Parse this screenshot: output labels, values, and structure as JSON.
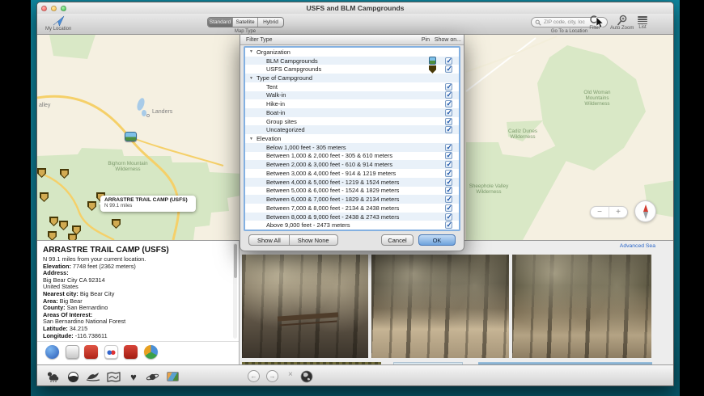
{
  "window": {
    "title": "USFS and BLM Campgrounds"
  },
  "toolbar": {
    "my_location_label": "My Location",
    "map_type_caption": "Map Type",
    "segments": [
      "Standard",
      "Satellite",
      "Hybrid"
    ],
    "search_placeholder": "ZIP code, city, loc",
    "search_caption": "Go To a Location",
    "filter_label": "Filter",
    "auto_zoom_label": "Auto Zoom",
    "list_label": "List"
  },
  "map": {
    "labels": [
      {
        "text": "alley"
      },
      {
        "text": "Landers"
      },
      {
        "text": "Bighorn Mountain\nWilderness"
      },
      {
        "text": "Old Woman\nMountains\nWilderness"
      },
      {
        "text": "Cadiz Dunes\nWilderness"
      },
      {
        "text": "Sheephole Valley\nWilderness"
      }
    ],
    "callout": {
      "title": "ARRASTRE TRAIL CAMP (USFS)",
      "distance": "N 99.1 miles"
    },
    "zoom_out": "−",
    "zoom_in": "+"
  },
  "filter_dialog": {
    "title_col": "Filter Type",
    "pin_col": "Pin",
    "show_col": "Show on...",
    "groups": [
      {
        "label": "Organization",
        "items": [
          {
            "label": "BLM Campgrounds",
            "pin": "blm",
            "checked": true
          },
          {
            "label": "USFS Campgrounds",
            "pin": "usfs",
            "checked": true
          }
        ]
      },
      {
        "label": "Type of Campground",
        "items": [
          {
            "label": "Tent",
            "checked": true
          },
          {
            "label": "Walk-in",
            "checked": true
          },
          {
            "label": "Hike-in",
            "checked": true
          },
          {
            "label": "Boat-in",
            "checked": true
          },
          {
            "label": "Group sites",
            "checked": true
          },
          {
            "label": "Uncategorized",
            "checked": true
          }
        ]
      },
      {
        "label": "Elevation",
        "items": [
          {
            "label": "Below 1,000 feet - 305 meters",
            "checked": true
          },
          {
            "label": "Between 1,000 & 2,000 feet - 305 & 610 meters",
            "checked": true
          },
          {
            "label": "Between 2,000 & 3,000 feet - 610 & 914 meters",
            "checked": true
          },
          {
            "label": "Between 3,000 & 4,000 feet - 914 & 1219 meters",
            "checked": true
          },
          {
            "label": "Between 4,000 & 5,000 feet - 1219 & 1524 meters",
            "checked": true
          },
          {
            "label": "Between 5,000 & 6,000 feet - 1524 & 1829 meters",
            "checked": true
          },
          {
            "label": "Between 6,000 & 7,000 feet - 1829 & 2134 meters",
            "checked": true
          },
          {
            "label": "Between 7,000 & 8,000 feet - 2134 & 2438 meters",
            "checked": true
          },
          {
            "label": "Between 8,000 & 9,000 feet - 2438 & 2743 meters",
            "checked": true
          },
          {
            "label": "Above 9,000 feet - 2473 meters",
            "checked": true
          }
        ]
      }
    ],
    "show_all": "Show All",
    "show_none": "Show None",
    "cancel": "Cancel",
    "ok": "OK"
  },
  "detail_panel": {
    "title": "ARRASTRE TRAIL CAMP (USFS)",
    "lines": [
      {
        "t": "N 99.1 miles from your current location."
      },
      {
        "b": "Elevation:",
        "t": " 7748 feet (2362 meters)"
      },
      {
        "b": "Address:"
      },
      {
        "t": "Big Bear City CA 92314"
      },
      {
        "t": "United States"
      },
      {
        "b": "Nearest city:",
        "t": " Big Bear City"
      },
      {
        "b": "Area:",
        "t": " Big Bear"
      },
      {
        "b": "County:",
        "t": " San Bernardino"
      },
      {
        "b": "Areas Of Interest:"
      },
      {
        "t": "San Bernardino National Forest"
      },
      {
        "b": "Latitude:",
        "t": " 34.215"
      },
      {
        "b": "Longitude:",
        "t": " -116.738611"
      }
    ]
  },
  "photos": {
    "advanced_link": "Advanced Sea"
  }
}
